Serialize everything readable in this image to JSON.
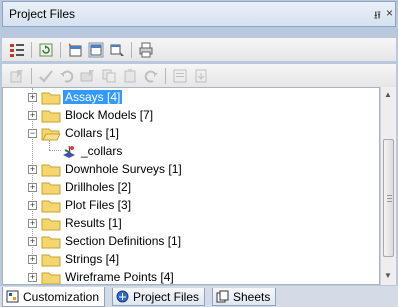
{
  "panel": {
    "title": "Project Files",
    "pin_glyph": "⭿",
    "close_glyph": "×"
  },
  "tree": {
    "items": [
      {
        "label": "Assays [4]",
        "expander": "+",
        "selected": true
      },
      {
        "label": "Block Models [7]",
        "expander": "+",
        "selected": false
      },
      {
        "label": "Collars [1]",
        "expander": "−",
        "selected": false
      },
      {
        "label": "_collars",
        "child": true
      },
      {
        "label": "Downhole Surveys [1]",
        "expander": "+",
        "selected": false
      },
      {
        "label": "Drillholes [2]",
        "expander": "+",
        "selected": false
      },
      {
        "label": "Plot Files [3]",
        "expander": "+",
        "selected": false
      },
      {
        "label": "Results [1]",
        "expander": "+",
        "selected": false
      },
      {
        "label": "Section Definitions [1]",
        "expander": "+",
        "selected": false
      },
      {
        "label": "Strings [4]",
        "expander": "+",
        "selected": false
      },
      {
        "label": "Wireframe Points [4]",
        "expander": "+",
        "selected": false
      }
    ]
  },
  "tabs": [
    {
      "label": "Customization",
      "icon": "customization-icon",
      "active": true
    },
    {
      "label": "Project Files",
      "icon": "project-files-icon",
      "active": false
    },
    {
      "label": "Sheets",
      "icon": "sheets-icon",
      "active": false
    }
  ],
  "colors": {
    "folder": "#f5d66e",
    "folder_edge": "#c9a233",
    "selection": "#3399ff"
  }
}
